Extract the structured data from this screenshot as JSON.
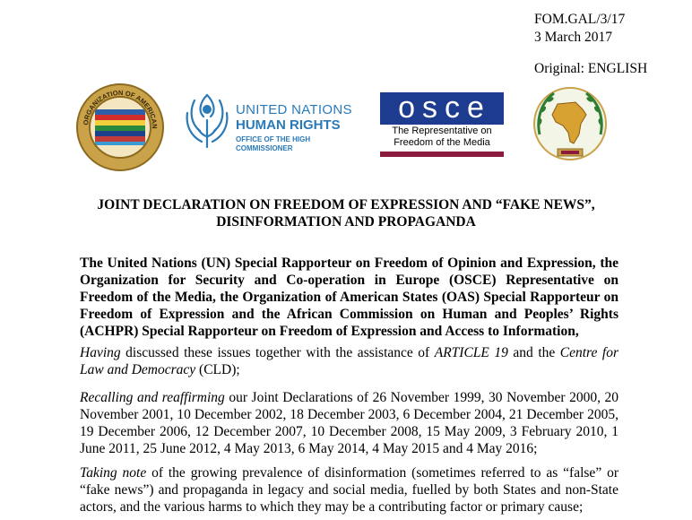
{
  "header": {
    "doc_code": "FOM.GAL/3/17",
    "date": "3 March 2017",
    "original": "Original: ENGLISH"
  },
  "logos": {
    "oas": {
      "text": "ORGANIZATION OF AMERICAN STATES",
      "icon": "oas-seal-icon"
    },
    "un": {
      "line1": "UNITED NATIONS",
      "line2": "HUMAN RIGHTS",
      "line3": "OFFICE OF THE HIGH COMMISSIONER",
      "icon": "un-emblem-icon",
      "color": "#2a7ab8"
    },
    "osce": {
      "letters": "osce",
      "line1": "The Representative on",
      "line2": "Freedom of the Media",
      "icon": "osce-logo-icon",
      "color": "#1d3c8f",
      "bar_color": "#8b1a3c"
    },
    "achpr": {
      "icon": "african-commission-emblem-icon",
      "color": "#2e7d32"
    }
  },
  "title": {
    "line1": "JOINT DECLARATION ON FREEDOM OF EXPRESSION AND “FAKE NEWS”,",
    "line2": "DISINFORMATION AND PROPAGANDA"
  },
  "intro": "The United Nations (UN) Special Rapporteur on Freedom of Opinion and Expression, the Organization for Security and Co-operation in Europe (OSCE) Representative on Freedom of the Media, the Organization of American States (OAS) Special Rapporteur on Freedom of Expression and the African Commission on Human and Peoples’ Rights (ACHPR) Special Rapporteur on Freedom of Expression and Access to Information,",
  "p1": {
    "lead": "Having",
    "text_a": " discussed these issues together with the assistance of ",
    "org1": "ARTICLE 19",
    "text_b": " and the ",
    "org2": "Centre for Law and Democracy",
    "text_c": " (CLD);"
  },
  "p2": {
    "lead": "Recalling and reaffirming",
    "text": " our Joint Declarations of 26 November 1999, 30 November 2000, 20 November 2001, 10 December 2002, 18 December 2003, 6 December 2004, 21 December 2005, 19 December 2006, 12 December 2007, 10 December 2008, 15 May 2009, 3 February 2010, 1 June 2011, 25 June 2012, 4 May 2013, 6 May 2014, 4 May 2015 and 4 May 2016;"
  },
  "p3": {
    "lead": "Taking note",
    "text": " of the growing prevalence of disinformation (sometimes referred to as “false” or “fake news”) and propaganda in legacy and social media, fuelled by both States and non-State actors, and the various harms to which they may be a contributing factor or primary cause;"
  }
}
